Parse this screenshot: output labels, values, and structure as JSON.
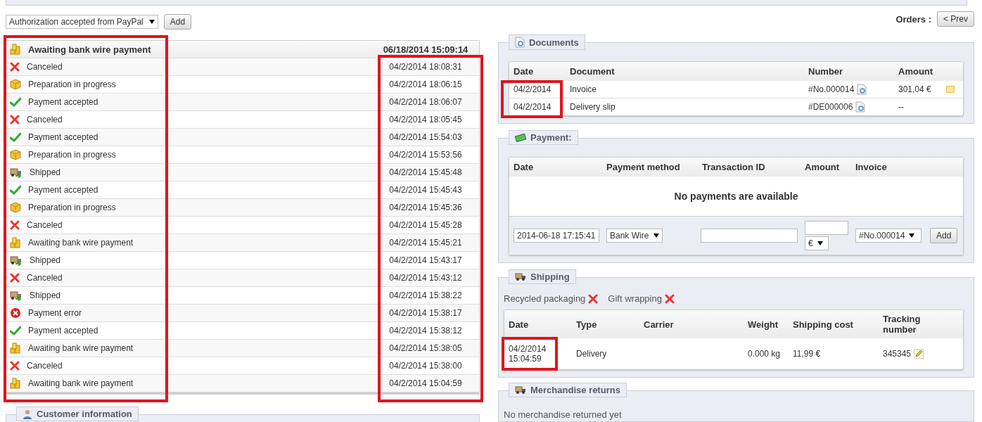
{
  "status_form": {
    "selected_status": "Authorization accepted from PayPal",
    "add_button": "Add"
  },
  "history": {
    "status_column_highlighted": true,
    "date_column_highlighted": true,
    "current": {
      "kind": "awaiting",
      "label": "Awaiting bank wire payment",
      "date": "06/18/2014 15:09:14"
    },
    "rows": [
      {
        "kind": "canceled",
        "label": "Canceled",
        "date": "04/2/2014 18:08:31"
      },
      {
        "kind": "preparation",
        "label": "Preparation in progress",
        "date": "04/2/2014 18:06:15"
      },
      {
        "kind": "accepted",
        "label": "Payment accepted",
        "date": "04/2/2014 18:06:07"
      },
      {
        "kind": "canceled",
        "label": "Canceled",
        "date": "04/2/2014 18:05:45"
      },
      {
        "kind": "accepted",
        "label": "Payment accepted",
        "date": "04/2/2014 15:54:03"
      },
      {
        "kind": "preparation",
        "label": "Preparation in progress",
        "date": "04/2/2014 15:53:56"
      },
      {
        "kind": "shipped",
        "label": "Shipped",
        "date": "04/2/2014 15:45:48"
      },
      {
        "kind": "accepted",
        "label": "Payment accepted",
        "date": "04/2/2014 15:45:43"
      },
      {
        "kind": "preparation",
        "label": "Preparation in progress",
        "date": "04/2/2014 15:45:36"
      },
      {
        "kind": "canceled",
        "label": "Canceled",
        "date": "04/2/2014 15:45:28"
      },
      {
        "kind": "awaiting",
        "label": "Awaiting bank wire payment",
        "date": "04/2/2014 15:45:21"
      },
      {
        "kind": "shipped",
        "label": "Shipped",
        "date": "04/2/2014 15:43:17"
      },
      {
        "kind": "canceled",
        "label": "Canceled",
        "date": "04/2/2014 15:43:12"
      },
      {
        "kind": "shipped",
        "label": "Shipped",
        "date": "04/2/2014 15:38:22"
      },
      {
        "kind": "error",
        "label": "Payment error",
        "date": "04/2/2014 15:38:17"
      },
      {
        "kind": "accepted",
        "label": "Payment accepted",
        "date": "04/2/2014 15:38:12"
      },
      {
        "kind": "awaiting",
        "label": "Awaiting bank wire payment",
        "date": "04/2/2014 15:38:05"
      },
      {
        "kind": "canceled",
        "label": "Canceled",
        "date": "04/2/2014 15:38:00"
      },
      {
        "kind": "awaiting",
        "label": "Awaiting bank wire payment",
        "date": "04/2/2014 15:04:59"
      }
    ]
  },
  "customer_panel": {
    "title": "Customer information"
  },
  "orders_nav": {
    "label": "Orders :",
    "prev_button": "< Prev"
  },
  "documents": {
    "title": "Documents",
    "date_column_highlighted": true,
    "columns": [
      "Date",
      "Document",
      "Number",
      "Amount"
    ],
    "rows": [
      {
        "date": "04/2/2014",
        "document": "Invoice",
        "number": "#No.000014",
        "amount": "301,04 €",
        "note": true
      },
      {
        "date": "04/2/2014",
        "document": "Delivery slip",
        "number": "#DE000006",
        "amount": "--",
        "note": false
      }
    ]
  },
  "payment": {
    "title": "Payment:",
    "columns": [
      "Date",
      "Payment method",
      "Transaction ID",
      "Amount",
      "Invoice"
    ],
    "empty_message": "No payments are available",
    "form": {
      "date": "2014-06-18 17:15:41",
      "method": "Bank Wire",
      "currency": "€",
      "invoice": "#No.000014",
      "add_button": "Add"
    }
  },
  "shipping": {
    "title": "Shipping",
    "date_column_highlighted": true,
    "options": [
      {
        "label": "Recycled packaging",
        "on": false
      },
      {
        "label": "Gift wrapping",
        "on": false
      }
    ],
    "columns": [
      "Date",
      "Type",
      "Carrier",
      "Weight",
      "Shipping cost",
      "Tracking number"
    ],
    "rows": [
      {
        "date": "04/2/2014 15:04:59",
        "type": "Delivery",
        "weight": "0.000 kg",
        "cost": "11,99 €",
        "tracking": "345345"
      }
    ]
  },
  "returns": {
    "title": "Merchandise returns",
    "message": "No merchandise returned yet"
  }
}
